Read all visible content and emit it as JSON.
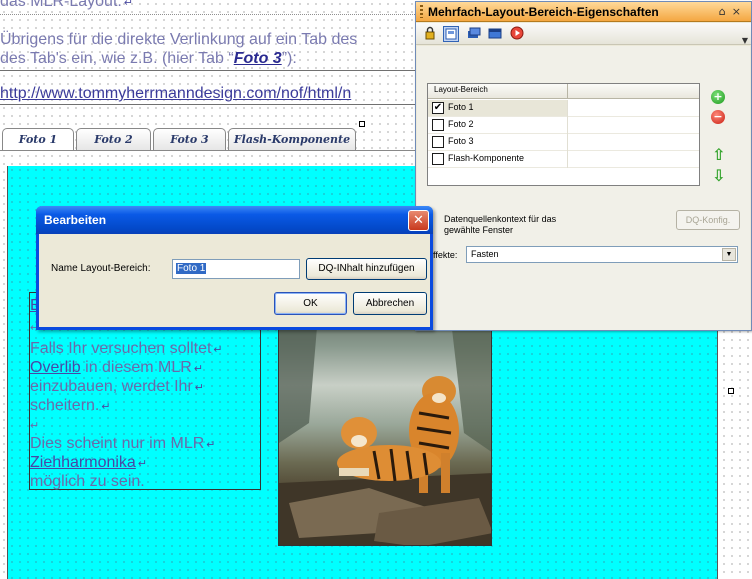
{
  "editor": {
    "line1": "das MLR-Layout.",
    "line2": "Übrigens für die direkte Verlinkung auf ein Tab des",
    "line3_before": "des Tab's ein, wie z.B. (hier Tab “",
    "line3_link": "Foto 3",
    "line3_after": "”):",
    "url": "http://www.tommyherrmanndesign.com/nof/html/n",
    "tabs": [
      "Foto 1",
      "Foto 2",
      "Foto 3",
      "Flash-Komponente"
    ],
    "textbox": {
      "first": "E",
      "line1": "Falls Ihr versuchen solltet",
      "line2": "Overlib",
      "line2_after": " in diesem MLR",
      "line3": "einzubauen, werdet Ihr",
      "line4": "scheitern.",
      "line5": "Dies scheint nur im MLR",
      "line6": "Ziehharmonika",
      "line7": "möglich zu sein."
    },
    "return_mark": "↵"
  },
  "panel": {
    "title": "Mehrfach-Layout-Bereich-Eigenschaften",
    "pin": "⌂",
    "close": "×",
    "list_header": "Layout-Bereich",
    "rows": [
      {
        "label": "Foto 1",
        "checked": "✔"
      },
      {
        "label": "Foto 2",
        "checked": ""
      },
      {
        "label": "Foto 3",
        "checked": ""
      },
      {
        "label": "Flash-Komponente",
        "checked": ""
      }
    ],
    "add": "+",
    "remove": "−",
    "up": "⇧",
    "down": "⇩",
    "context_label": "Datenquellenkontext für das gewählte Fenster",
    "dq_button": "DQ-Konfig.",
    "effects_label": "ffekte:",
    "effects_value": "Fasten",
    "icons": [
      "lock-icon",
      "page-icon",
      "layers-icon",
      "window-icon",
      "play-icon"
    ]
  },
  "dialog": {
    "title": "Bearbeiten",
    "close": "✕",
    "name_label": "Name Layout-Bereich:",
    "name_value": "Foto 1",
    "dq_button": "DQ-INhalt hinzufügen",
    "ok": "OK",
    "cancel": "Abbrechen"
  },
  "colors": {
    "cyan": "#00ffff",
    "panel_title": "#f4a742",
    "dialog_title": "#0a5ae6",
    "accent": "#316ac5"
  }
}
